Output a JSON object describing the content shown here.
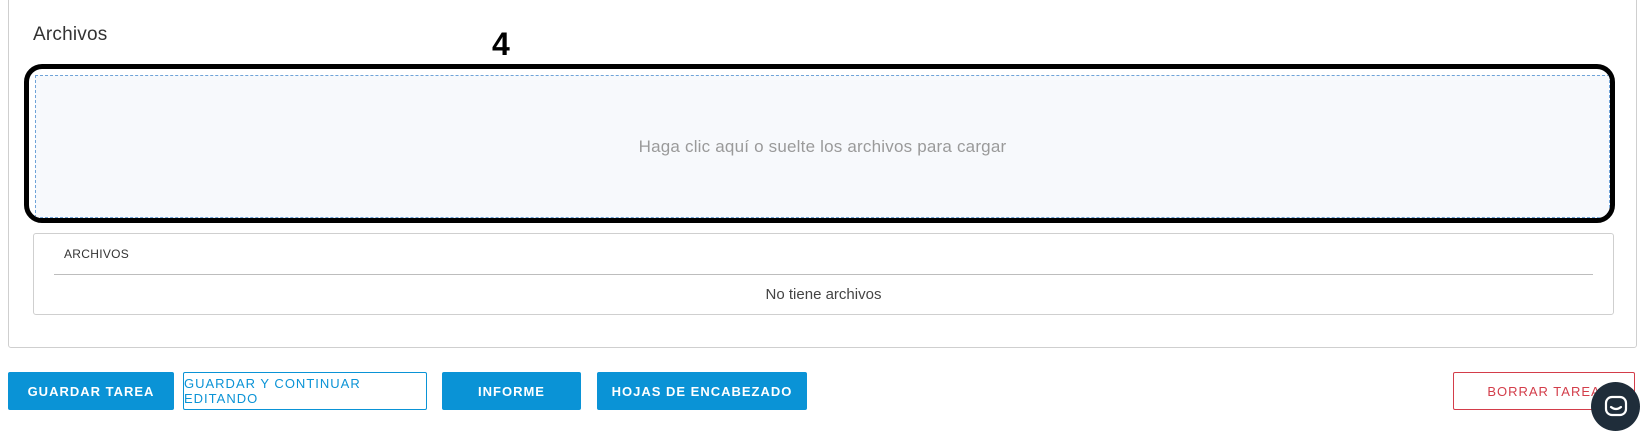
{
  "section": {
    "title": "Archivos"
  },
  "annotation": {
    "marker": "4"
  },
  "dropzone": {
    "text": "Haga clic aquí o suelte los archivos para cargar"
  },
  "files_table": {
    "header": "ARCHIVOS",
    "empty_message": "No tiene archivos"
  },
  "actions": {
    "save": "GUARDAR TAREA",
    "save_continue": "GUARDAR Y CONTINUAR EDITANDO",
    "report": "INFORME",
    "header_sheets": "HOJAS DE ENCABEZADO",
    "delete": "BORRAR TAREA"
  },
  "icons": {
    "chat": "chat-bubble-icon"
  },
  "colors": {
    "primary": "#0a93d6",
    "danger": "#d33d4a",
    "chat_bg": "#1f2d3a"
  }
}
